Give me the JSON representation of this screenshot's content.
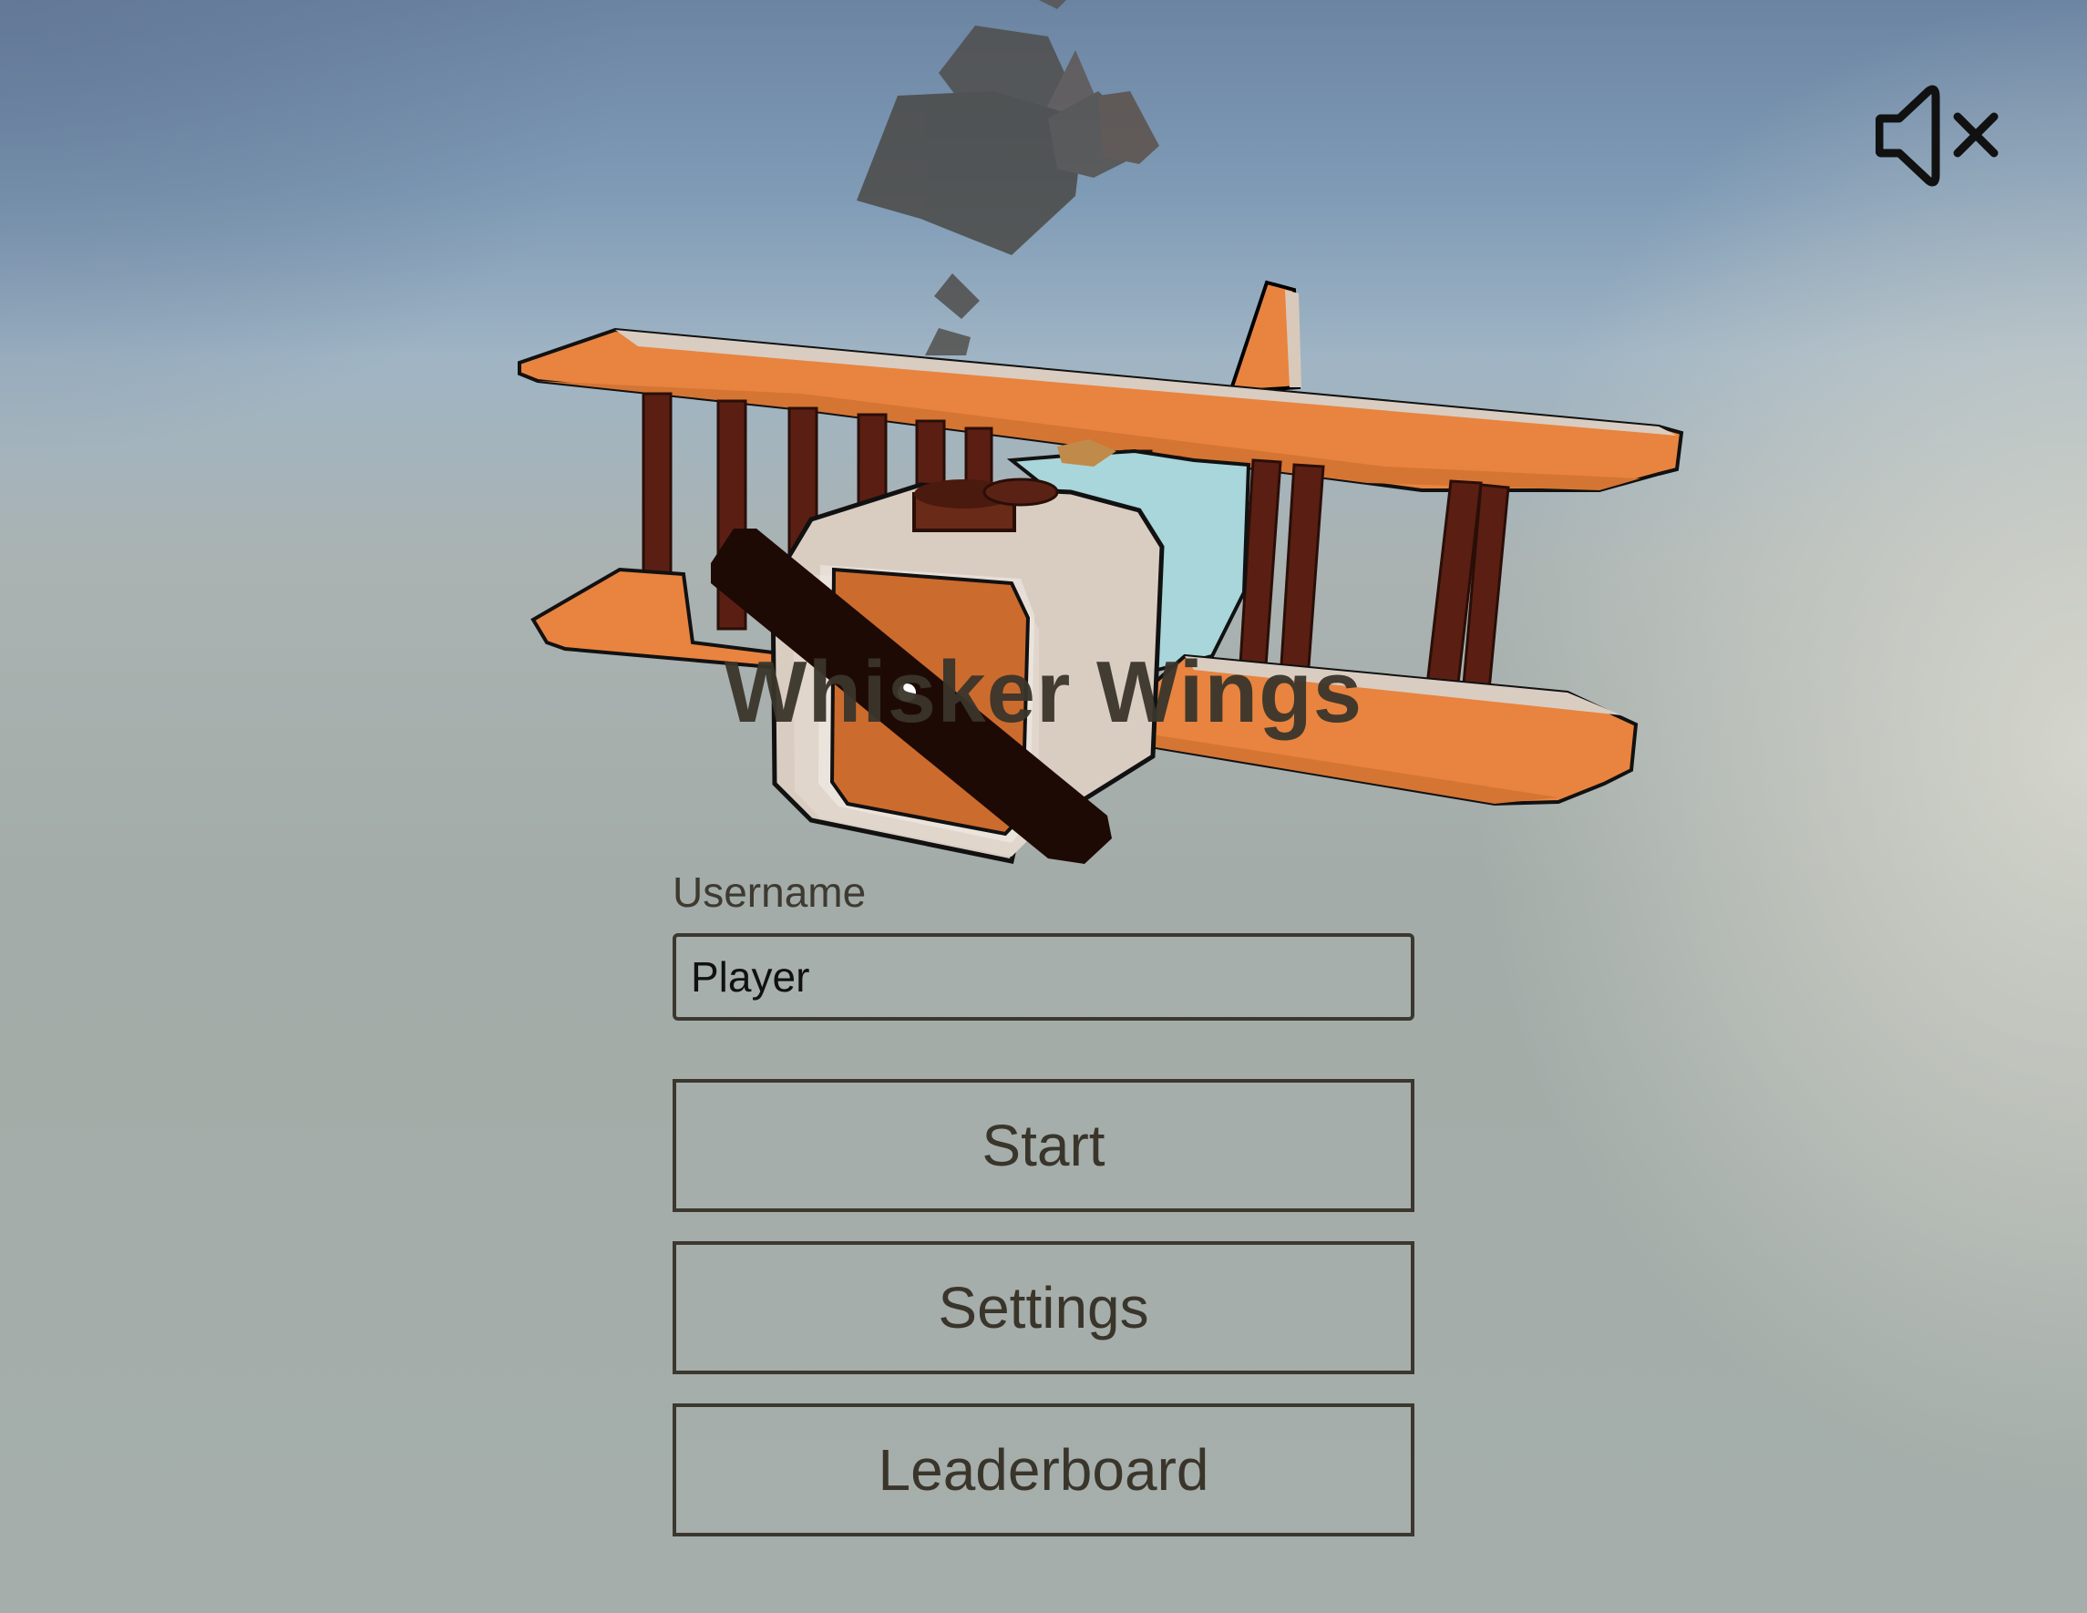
{
  "game": {
    "title": "Whisker Wings"
  },
  "audio": {
    "mute_icon": "speaker-muted-icon"
  },
  "login": {
    "username_label": "Username",
    "username_value": "Player"
  },
  "menu": {
    "start_label": "Start",
    "settings_label": "Settings",
    "leaderboard_label": "Leaderboard"
  },
  "colors": {
    "text": "#3a352b",
    "plane_orange": "#e8843f",
    "plane_strut": "#5a1f12",
    "propeller": "#1e0a04",
    "smoke": "#4a4845"
  }
}
